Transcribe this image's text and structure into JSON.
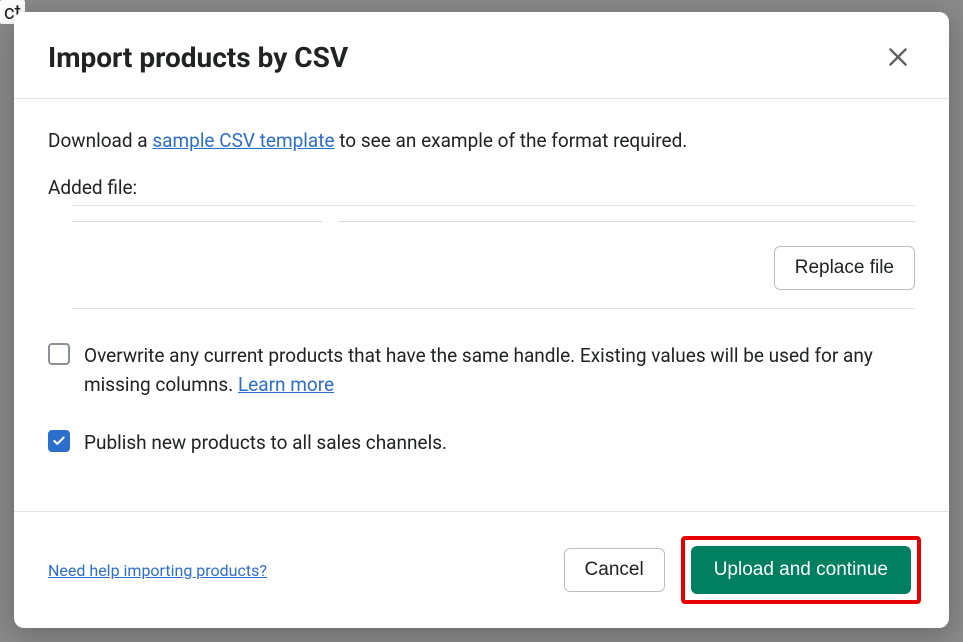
{
  "background": {
    "fragment": "ct"
  },
  "modal": {
    "title": "Import products by CSV",
    "description": {
      "before": "Download a ",
      "link": "sample CSV template",
      "after": " to see an example of the format required."
    },
    "added_file_label": "Added file:",
    "replace_file_label": "Replace file",
    "options": {
      "overwrite": {
        "checked": false,
        "text": "Overwrite any current products that have the same handle. Existing values will be used for any missing columns. ",
        "learn_more": "Learn more"
      },
      "publish": {
        "checked": true,
        "text": "Publish new products to all sales channels."
      }
    },
    "footer": {
      "help_link": "Need help importing products?",
      "cancel": "Cancel",
      "upload": "Upload and continue"
    }
  }
}
